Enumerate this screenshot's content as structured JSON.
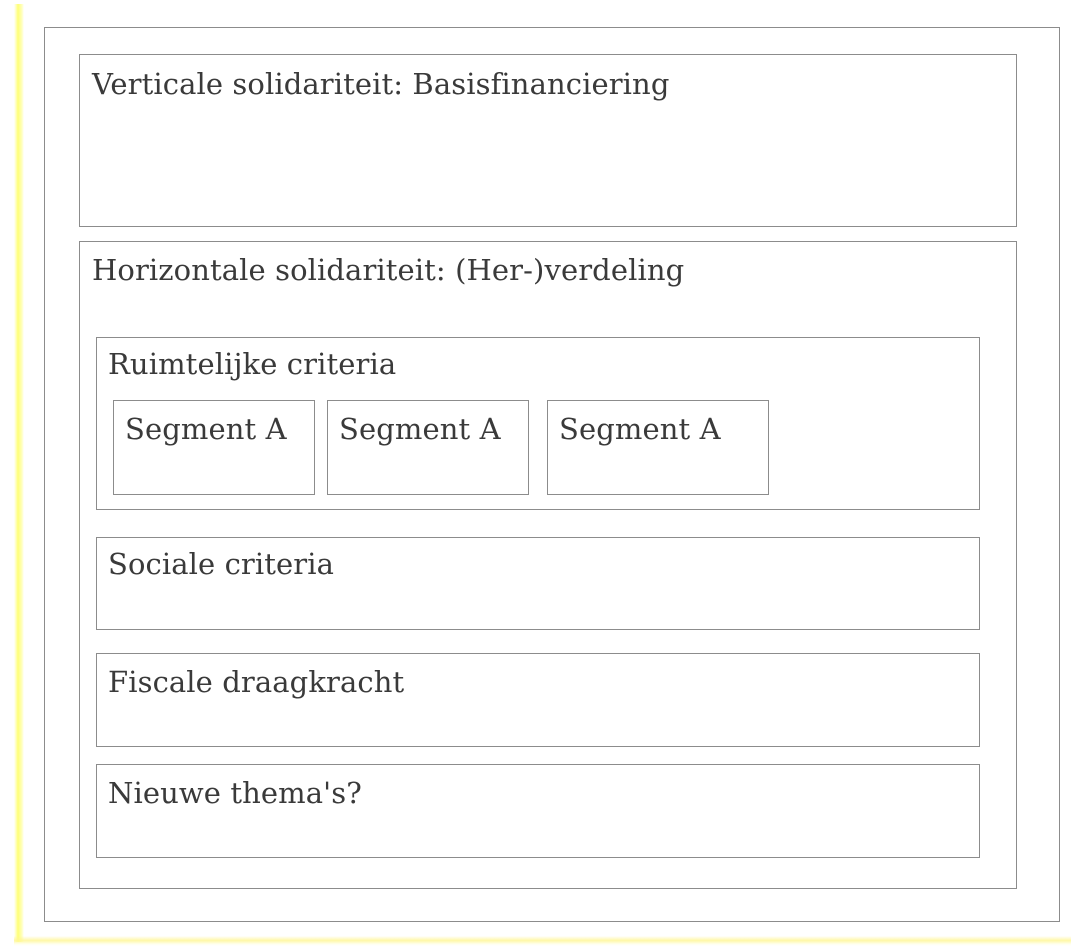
{
  "vertical": {
    "title": "Verticale solidariteit: Basisfinanciering"
  },
  "horizontal": {
    "title": "Horizontale solidariteit: (Her-)verdeling",
    "ruimtelijk": {
      "title": "Ruimtelijke criteria",
      "segments": [
        "Segment A",
        "Segment A",
        "Segment A"
      ]
    },
    "sociaal": {
      "title": "Sociale criteria"
    },
    "fiscaal": {
      "title": "Fiscale draagkracht"
    },
    "nieuw": {
      "title": "Nieuwe thema's?"
    }
  }
}
